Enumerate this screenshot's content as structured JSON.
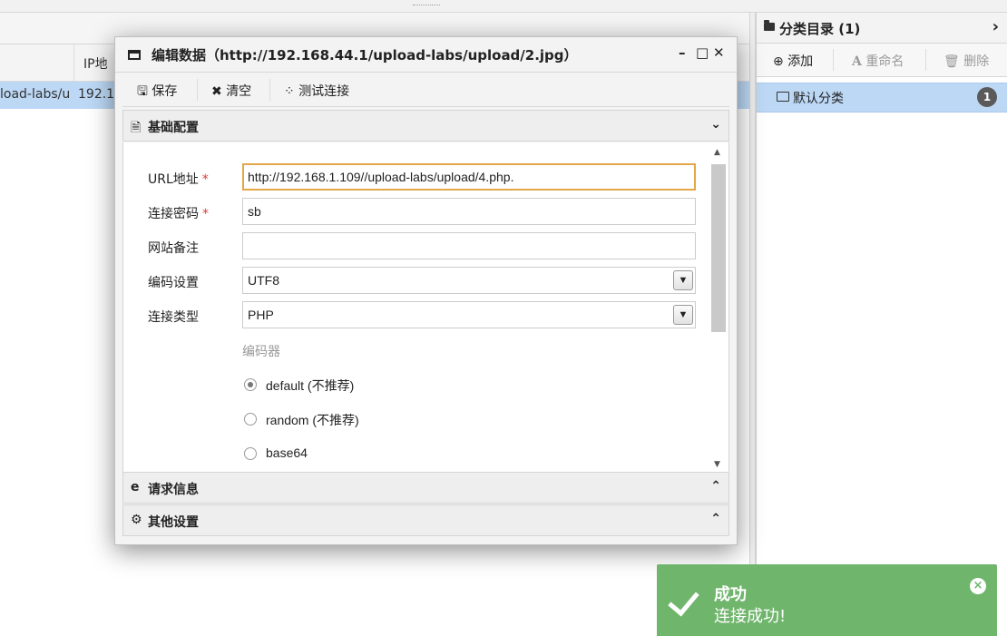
{
  "background": {
    "columns": {
      "ip_header": "IP地"
    },
    "row": {
      "url_fragment": "load-labs/u",
      "ip_fragment": "192.1"
    }
  },
  "category_panel": {
    "title": "分类目录 (1)",
    "expand_icon": "chevron-right-icon",
    "toolbar": {
      "add_label": "添加",
      "rename_label": "重命名",
      "delete_label": "删除"
    },
    "items": [
      {
        "label": "默认分类",
        "count": "1",
        "icon": "folder-icon"
      }
    ]
  },
  "edit_dialog": {
    "title": "编辑数据（http://192.168.44.1/upload-labs/upload/2.jpg）",
    "window_controls": {
      "minimize": "–",
      "maximize": "□",
      "close": "✕"
    },
    "toolbar": {
      "save_label": "保存",
      "clear_label": "清空",
      "test_label": "测试连接"
    },
    "sections": {
      "basic": {
        "title": "基础配置",
        "expanded": true
      },
      "request": {
        "title": "请求信息",
        "expanded": false
      },
      "other": {
        "title": "其他设置",
        "expanded": false
      }
    },
    "form": {
      "url": {
        "label": "URL地址",
        "required_mark": "*",
        "value": "http://192.168.1.109//upload-labs/upload/4.php."
      },
      "password": {
        "label": "连接密码",
        "required_mark": "*",
        "value": "sb"
      },
      "note": {
        "label": "网站备注",
        "value": ""
      },
      "encoding": {
        "label": "编码设置",
        "value": "UTF8"
      },
      "type": {
        "label": "连接类型",
        "value": "PHP"
      },
      "encoder": {
        "label": "编码器",
        "options": [
          {
            "label": "default (不推荐)",
            "selected": true
          },
          {
            "label": "random (不推荐)",
            "selected": false
          },
          {
            "label": "base64",
            "selected": false
          }
        ]
      }
    }
  },
  "toast": {
    "title": "成功",
    "message": "连接成功!",
    "color": "#6fb56c"
  }
}
